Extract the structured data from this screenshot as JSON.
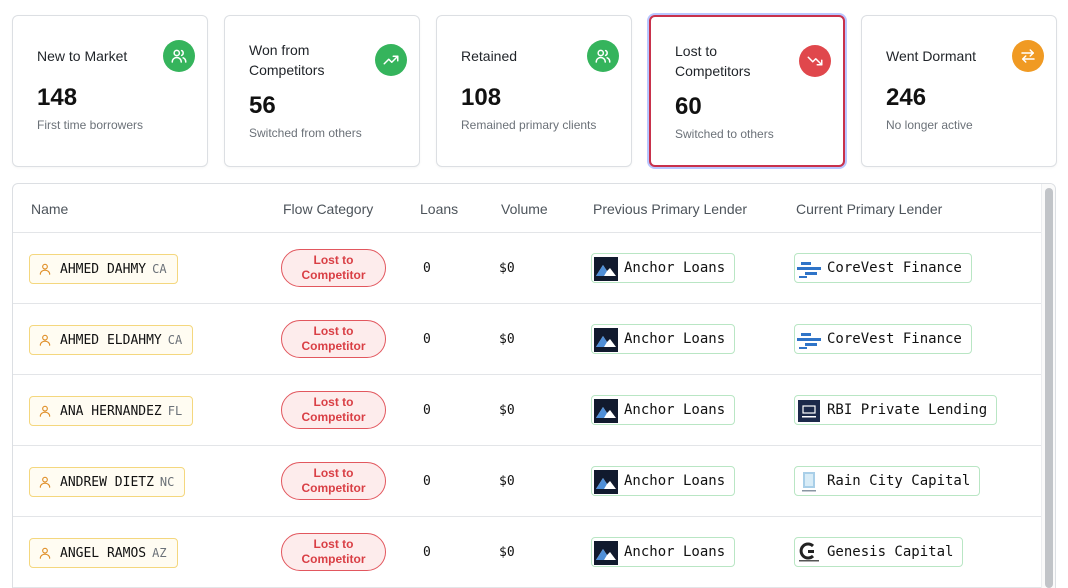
{
  "cards": [
    {
      "title": "New to Market",
      "value": "148",
      "subtitle": "First time borrowers",
      "icon": "users-icon",
      "color": "#35b45c"
    },
    {
      "title": "Won from Competitors",
      "value": "56",
      "subtitle": "Switched from others",
      "icon": "trending-up-icon",
      "color": "#35b45c"
    },
    {
      "title": "Retained",
      "value": "108",
      "subtitle": "Remained primary clients",
      "icon": "users-icon",
      "color": "#35b45c"
    },
    {
      "title": "Lost to Competitors",
      "value": "60",
      "subtitle": "Switched to others",
      "icon": "trending-down-icon",
      "color": "#e0474c"
    },
    {
      "title": "Went Dormant",
      "value": "246",
      "subtitle": "No longer active",
      "icon": "swap-arrows-icon",
      "color": "#f09a23"
    }
  ],
  "table": {
    "headers": {
      "name": "Name",
      "flow": "Flow Category",
      "loans": "Loans",
      "volume": "Volume",
      "previous": "Previous Primary Lender",
      "current": "Current Primary Lender"
    },
    "rows": [
      {
        "name": "AHMED DAHMY",
        "state": "CA",
        "flow": "Lost to Competitor",
        "loans": "0",
        "volume": "$0",
        "previous": "Anchor Loans",
        "current": "CoreVest Finance",
        "current_logo": "corevest"
      },
      {
        "name": "AHMED ELDAHMY",
        "state": "CA",
        "flow": "Lost to Competitor",
        "loans": "0",
        "volume": "$0",
        "previous": "Anchor Loans",
        "current": "CoreVest Finance",
        "current_logo": "corevest"
      },
      {
        "name": "ANA HERNANDEZ",
        "state": "FL",
        "flow": "Lost to Competitor",
        "loans": "0",
        "volume": "$0",
        "previous": "Anchor Loans",
        "current": "RBI Private Lending",
        "current_logo": "rbi"
      },
      {
        "name": "ANDREW DIETZ",
        "state": "NC",
        "flow": "Lost to Competitor",
        "loans": "0",
        "volume": "$0",
        "previous": "Anchor Loans",
        "current": "Rain City Capital",
        "current_logo": "raincity"
      },
      {
        "name": "ANGEL RAMOS",
        "state": "AZ",
        "flow": "Lost to Competitor",
        "loans": "0",
        "volume": "$0",
        "previous": "Anchor Loans",
        "current": "Genesis Capital",
        "current_logo": "genesis"
      }
    ]
  }
}
